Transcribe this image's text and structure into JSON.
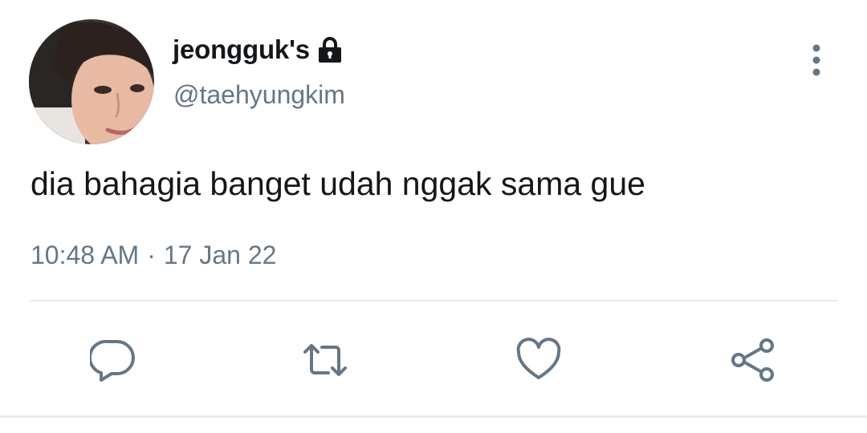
{
  "user": {
    "display_name": "jeongguk's",
    "handle": "@taehyungkim",
    "protected": true
  },
  "tweet": {
    "text": "dia bahagia banget udah nggak sama gue",
    "time": "10:48 AM",
    "separator": "·",
    "date": "17 Jan 22"
  },
  "icons": {
    "avatar": "avatar-photo",
    "lock": "lock-icon",
    "more": "more-vertical-icon",
    "reply": "reply-icon",
    "retweet": "retweet-icon",
    "like": "heart-icon",
    "share": "share-icon"
  },
  "colors": {
    "text_primary": "#14171a",
    "text_secondary": "#657786",
    "divider": "#e6ecf0",
    "icon": "#657786"
  }
}
